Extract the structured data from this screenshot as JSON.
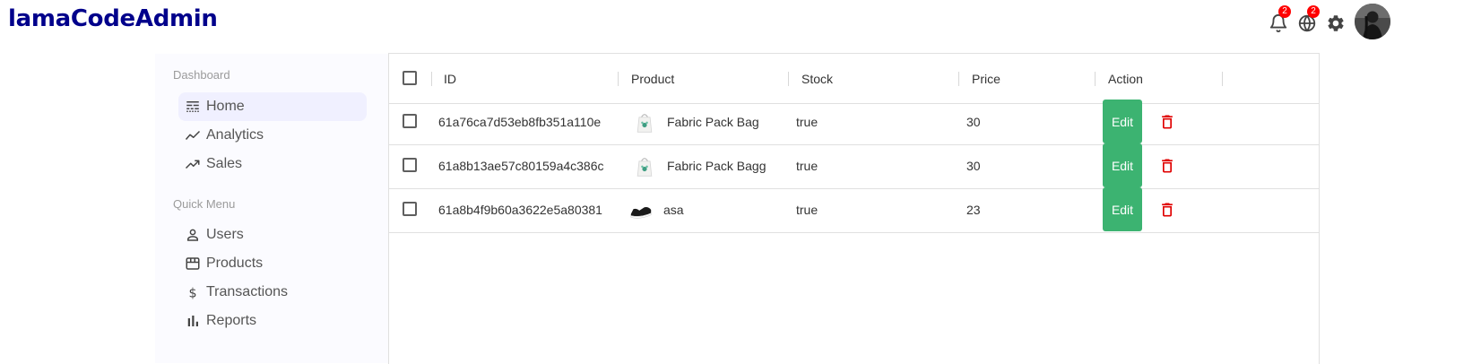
{
  "app": {
    "logo": "lamaCodeAdmin"
  },
  "topbar": {
    "notifications_badge": "2",
    "language_badge": "2",
    "icons": [
      "bell-icon",
      "globe-icon",
      "gear-icon",
      "avatar"
    ]
  },
  "sidebar": {
    "sections": [
      {
        "title": "Dashboard",
        "items": [
          {
            "label": "Home",
            "icon": "line-style-icon",
            "active": true
          },
          {
            "label": "Analytics",
            "icon": "timeline-icon"
          },
          {
            "label": "Sales",
            "icon": "trending-up-icon"
          }
        ]
      },
      {
        "title": "Quick Menu",
        "items": [
          {
            "label": "Users",
            "icon": "person-outline-icon"
          },
          {
            "label": "Products",
            "icon": "storefront-icon"
          },
          {
            "label": "Transactions",
            "icon": "dollar-icon"
          },
          {
            "label": "Reports",
            "icon": "bar-chart-icon"
          }
        ]
      }
    ]
  },
  "table": {
    "columns": [
      "ID",
      "Product",
      "Stock",
      "Price",
      "Action"
    ],
    "edit_label": "Edit",
    "rows": [
      {
        "id": "61a76ca7d53eb8fb351a110e",
        "product": "Fabric Pack Bag",
        "image": "bag",
        "stock": "true",
        "price": "30"
      },
      {
        "id": "61a8b13ae57c80159a4c386c",
        "product": "Fabric Pack Bagg",
        "image": "bag",
        "stock": "true",
        "price": "30"
      },
      {
        "id": "61a8b4f9b60a3622e5a80381",
        "product": "asa",
        "image": "shoe",
        "stock": "true",
        "price": "23"
      }
    ]
  },
  "colors": {
    "logo": "#00008b",
    "edit_button": "#3cb371",
    "delete_icon": "#e00000",
    "badge": "#ff0000",
    "sidebar_bg": "#fbfbff",
    "active_item_bg": "#f0f0ff"
  }
}
